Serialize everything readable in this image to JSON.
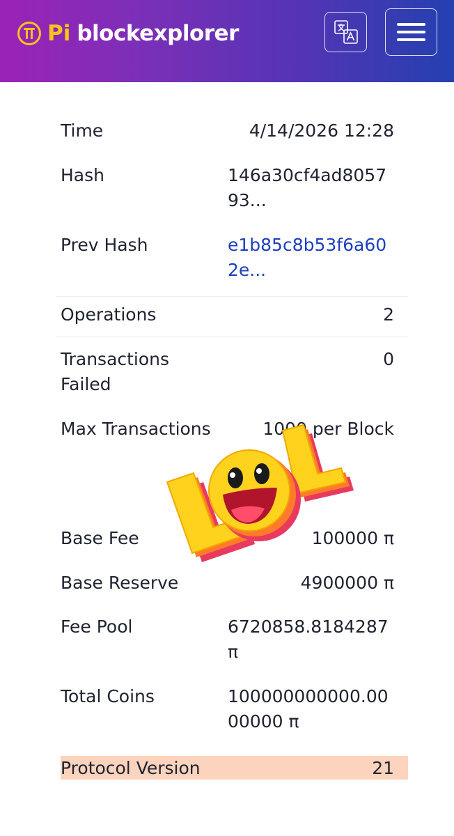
{
  "header": {
    "brand_pi": "Pi",
    "brand_text": "blockexplorer",
    "translate_icon": "translate-icon",
    "menu_icon": "hamburger-menu-icon",
    "colors": {
      "gradient_start": "#9b22b6",
      "gradient_end": "#2440b0",
      "brand_accent": "#f7c21a"
    }
  },
  "details": {
    "time": {
      "label": "Time",
      "value": "4/14/2026 12:28"
    },
    "hash": {
      "label": "Hash",
      "value": "146a30cf4ad805793..."
    },
    "prev_hash": {
      "label": "Prev Hash",
      "value": "e1b85c8b53f6a602e..."
    },
    "operations": {
      "label": "Operations",
      "value": "2"
    },
    "transactions_failed": {
      "label_line1": "Transactions",
      "label_line2": "Failed",
      "value": "0"
    },
    "max_transactions": {
      "label": "Max Transactions",
      "value": "1000 per Block"
    },
    "base_fee": {
      "label": "Base Fee",
      "value": "100000 π"
    },
    "base_reserve": {
      "label": "Base Reserve",
      "value": "4900000 π"
    },
    "fee_pool": {
      "label": "Fee Pool",
      "value": "6720858.8184287 π"
    },
    "total_coins": {
      "label": "Total Coins",
      "value": "100000000000.0000000 π"
    },
    "protocol_version": {
      "label": "Protocol Version",
      "value": "21"
    }
  },
  "sticker": {
    "text": "LOL",
    "icon": "laughing-face-icon"
  },
  "colors": {
    "link": "#1d3fbf",
    "highlight_row": "#fcd3bd"
  }
}
